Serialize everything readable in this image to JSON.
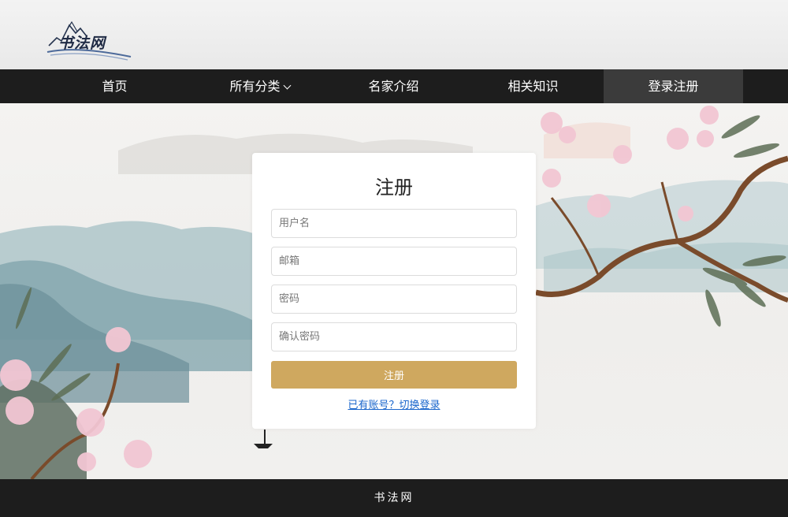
{
  "header": {
    "logo_text": "书法网"
  },
  "nav": {
    "items": [
      {
        "label": "首页",
        "active": false
      },
      {
        "label": "所有分类",
        "active": false,
        "has_dropdown": true
      },
      {
        "label": "名家介绍",
        "active": false
      },
      {
        "label": "相关知识",
        "active": false
      },
      {
        "label": "登录注册",
        "active": true
      }
    ]
  },
  "form": {
    "title": "注册",
    "username_placeholder": "用户名",
    "email_placeholder": "邮箱",
    "password_placeholder": "密码",
    "confirm_password_placeholder": "确认密码",
    "submit_label": "注册",
    "switch_link": "已有账号？切换登录"
  },
  "footer": {
    "text": "书法网"
  },
  "colors": {
    "nav_bg": "#1d1d1d",
    "nav_active_bg": "#3b3b3b",
    "submit_bg": "#cfa85f",
    "link": "#1a66cc"
  },
  "icons": {
    "dropdown": "chevron-down-icon",
    "logo": "mountain-logo-icon"
  }
}
